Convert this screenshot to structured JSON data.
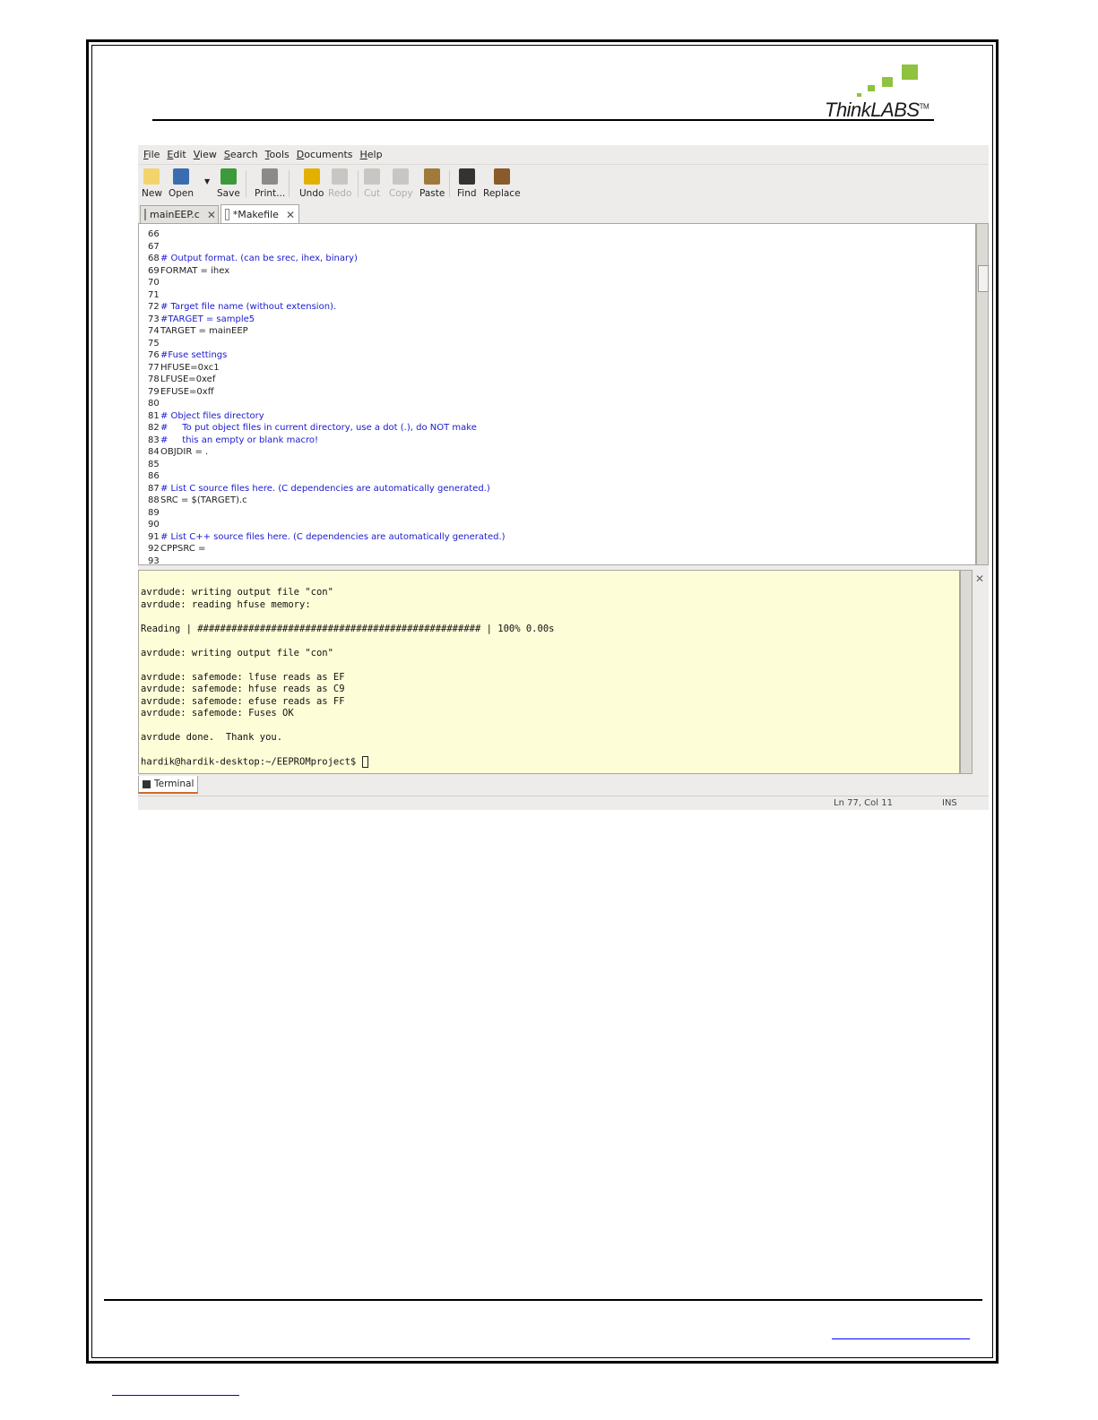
{
  "logo": {
    "text": "ThinkLABS",
    "tm": "TM"
  },
  "menu": [
    "File",
    "Edit",
    "View",
    "Search",
    "Tools",
    "Documents",
    "Help"
  ],
  "toolbar": [
    {
      "label": "New",
      "icon": "new-document-icon",
      "enabled": true
    },
    {
      "label": "Open",
      "icon": "open-folder-icon",
      "enabled": true
    },
    {
      "label": "Save",
      "icon": "save-icon",
      "enabled": true
    },
    {
      "label": "Print...",
      "icon": "printer-icon",
      "enabled": true
    },
    {
      "label": "Undo",
      "icon": "undo-icon",
      "enabled": true
    },
    {
      "label": "Redo",
      "icon": "redo-icon",
      "enabled": false
    },
    {
      "label": "Cut",
      "icon": "scissors-icon",
      "enabled": false
    },
    {
      "label": "Copy",
      "icon": "copy-icon",
      "enabled": false
    },
    {
      "label": "Paste",
      "icon": "paste-icon",
      "enabled": true
    },
    {
      "label": "Find",
      "icon": "binoculars-icon",
      "enabled": true
    },
    {
      "label": "Replace",
      "icon": "replace-icon",
      "enabled": true
    }
  ],
  "tabs": [
    {
      "label": "mainEEP.c",
      "active": false
    },
    {
      "label": "*Makefile",
      "active": true
    }
  ],
  "code_lines": [
    {
      "n": "66",
      "t": "",
      "c": false
    },
    {
      "n": "67",
      "t": "",
      "c": false
    },
    {
      "n": "68",
      "t": "# Output format. (can be srec, ihex, binary)",
      "c": true
    },
    {
      "n": "69",
      "t": "FORMAT = ihex",
      "c": false
    },
    {
      "n": "70",
      "t": "",
      "c": false
    },
    {
      "n": "71",
      "t": "",
      "c": false
    },
    {
      "n": "72",
      "t": "# Target file name (without extension).",
      "c": true
    },
    {
      "n": "73",
      "t": "#TARGET = sample5",
      "c": true
    },
    {
      "n": "74",
      "t": "TARGET = mainEEP",
      "c": false
    },
    {
      "n": "75",
      "t": "",
      "c": false
    },
    {
      "n": "76",
      "t": "#Fuse settings",
      "c": true
    },
    {
      "n": "77",
      "t": "HFUSE=0xc1",
      "c": false
    },
    {
      "n": "78",
      "t": "LFUSE=0xef",
      "c": false
    },
    {
      "n": "79",
      "t": "EFUSE=0xff",
      "c": false
    },
    {
      "n": "80",
      "t": "",
      "c": false
    },
    {
      "n": "81",
      "t": "# Object files directory",
      "c": true
    },
    {
      "n": "82",
      "t": "#     To put object files in current directory, use a dot (.), do NOT make",
      "c": true
    },
    {
      "n": "83",
      "t": "#     this an empty or blank macro!",
      "c": true
    },
    {
      "n": "84",
      "t": "OBJDIR = .",
      "c": false
    },
    {
      "n": "85",
      "t": "",
      "c": false
    },
    {
      "n": "86",
      "t": "",
      "c": false
    },
    {
      "n": "87",
      "t": "# List C source files here. (C dependencies are automatically generated.)",
      "c": true
    },
    {
      "n": "88",
      "t": "SRC = $(TARGET).c",
      "c": false
    },
    {
      "n": "89",
      "t": "",
      "c": false
    },
    {
      "n": "90",
      "t": "",
      "c": false
    },
    {
      "n": "91",
      "t": "# List C++ source files here. (C dependencies are automatically generated.)",
      "c": true
    },
    {
      "n": "92",
      "t": "CPPSRC =",
      "c": false
    },
    {
      "n": "93",
      "t": "",
      "c": false
    }
  ],
  "terminal_lines": [
    "avrdude: writing output file \"con\"",
    "avrdude: reading hfuse memory:",
    "",
    "Reading | ################################################## | 100% 0.00s",
    "",
    "avrdude: writing output file \"con\"",
    "",
    "avrdude: safemode: lfuse reads as EF",
    "avrdude: safemode: hfuse reads as C9",
    "avrdude: safemode: efuse reads as FF",
    "avrdude: safemode: Fuses OK",
    "",
    "avrdude done.  Thank you.",
    "",
    "hardik@hardik-desktop:~/EEPROMproject$ "
  ],
  "terminal_tab": "Terminal",
  "status": {
    "position": "Ln 77, Col 11",
    "mode": "INS"
  }
}
